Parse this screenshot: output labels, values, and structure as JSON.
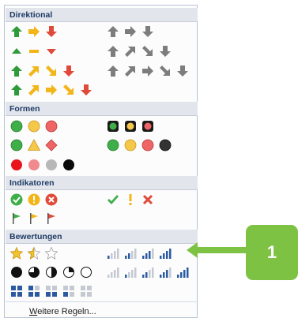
{
  "categories": {
    "directional": "Direktional",
    "shapes": "Formen",
    "indicators": "Indikatoren",
    "ratings": "Bewertungen"
  },
  "icons": {
    "arrow-up": "arrow-up-icon",
    "arrow-right": "arrow-right-icon",
    "arrow-down": "arrow-down-icon",
    "circle": "circle-icon",
    "triangle": "triangle-icon",
    "diamond": "diamond-icon",
    "check": "check-icon",
    "exclamation": "exclamation-icon",
    "cross": "cross-icon",
    "flag": "flag-icon",
    "star": "star-icon",
    "signal-bars": "signal-bars-icon",
    "quarters": "quarter-circle-icon",
    "boxes": "box-rating-icon"
  },
  "colors": {
    "green": "#2e9a3a",
    "yellow": "#f2b619",
    "red": "#e04a3a",
    "gray": "#7d7d7d",
    "header_bg": "#e2e6ec",
    "header_text": "#1e3a66",
    "callout": "#7dc243",
    "bars_blue": "#2c5aa0"
  },
  "footer": {
    "more_rules_underlined": "W",
    "more_rules_rest": "eitere Regeln..."
  },
  "callout": {
    "number": "1"
  }
}
